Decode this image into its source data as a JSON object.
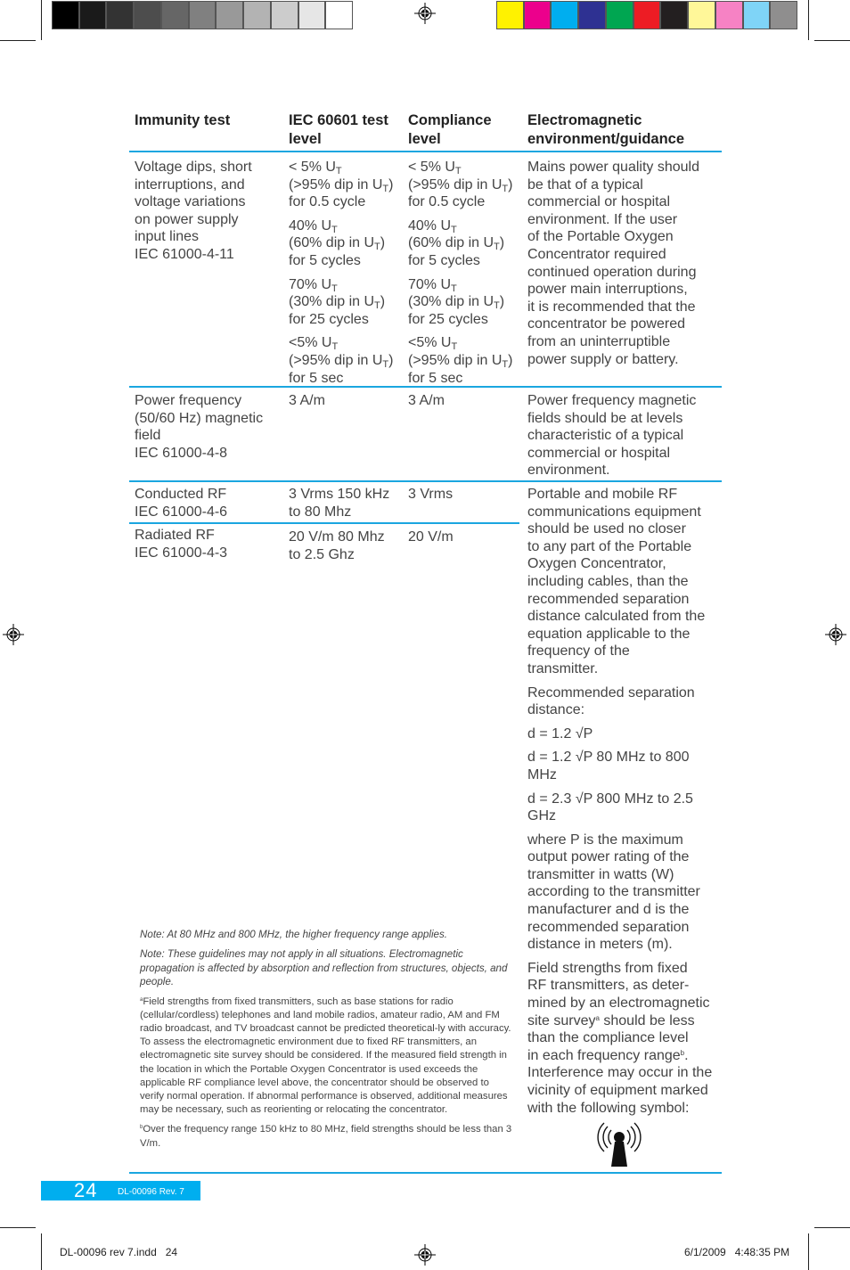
{
  "print_marks": {
    "gray_swatches": [
      "#000000",
      "#1a1a1a",
      "#333333",
      "#4d4d4d",
      "#666666",
      "#808080",
      "#999999",
      "#b3b3b3",
      "#cccccc",
      "#e6e6e6",
      "#ffffff"
    ],
    "color_swatches": [
      "#fff200",
      "#ec008c",
      "#00aeef",
      "#2e3192",
      "#00a651",
      "#ed1c24",
      "#231f20",
      "#fff799",
      "#f682c4",
      "#7fd4f7",
      "#8f8e8e"
    ],
    "slug_left": "DL-00096 rev 7.indd   24",
    "slug_right": "6/1/2009   4:48:35 PM"
  },
  "table": {
    "headers": [
      "Immunity test",
      "IEC 60601 test level",
      "Compliance level",
      "Electromagnetic environment/guidance"
    ],
    "rows": {
      "voltage": {
        "test": [
          "Voltage dips, short",
          "interruptions, and",
          "voltage variations",
          "on power supply",
          "input lines",
          "IEC 61000-4-11"
        ],
        "iec_levels": [
          {
            "pre": "< 5% U",
            "sub": "T",
            "dip_pre": "(>95% dip in U",
            "dip_sub": "T",
            "dip_post": ")",
            "duration": "for 0.5 cycle"
          },
          {
            "pre": "40% U",
            "sub": "T",
            "dip_pre": "(60% dip in U",
            "dip_sub": "T",
            "dip_post": ")",
            "duration": "for 5 cycles"
          },
          {
            "pre": "70% U",
            "sub": "T",
            "dip_pre": "(30% dip in U",
            "dip_sub": "T",
            "dip_post": ")",
            "duration": "for 25 cycles"
          },
          {
            "pre": "<5% U",
            "sub": "T",
            "dip_pre": "(>95% dip in U",
            "dip_sub": "T",
            "dip_post": ")",
            "duration": "for 5 sec"
          }
        ],
        "compliance_levels": [
          {
            "pre": "< 5% U",
            "sub": "T",
            "dip_pre": "(>95% dip in U",
            "dip_sub": "T",
            "dip_post": ")",
            "duration": "for 0.5 cycle"
          },
          {
            "pre": "40% U",
            "sub": "T",
            "dip_pre": "(60% dip in U",
            "dip_sub": "T",
            "dip_post": ")",
            "duration": "for 5 cycles"
          },
          {
            "pre": "70% U",
            "sub": "T",
            "dip_pre": "(30% dip in U",
            "dip_sub": "T",
            "dip_post": ")",
            "duration": "for 25 cycles"
          },
          {
            "pre": "<5% U",
            "sub": "T",
            "dip_pre": "(>95% dip in U",
            "dip_sub": "T",
            "dip_post": ")",
            "duration": "for 5 sec"
          }
        ],
        "guidance": [
          "Mains power quality should",
          "be that of a typical",
          "commercial or hospital",
          "environment. If the user",
          "of the Portable Oxygen",
          "Concentrator required",
          "continued operation during",
          "power main interruptions,",
          "it is recommended that the",
          "concentrator be powered",
          "from an uninterruptible",
          "power supply or battery."
        ]
      },
      "power_freq": {
        "test": [
          "Power frequency",
          "(50/60 Hz) magnetic",
          "field",
          "IEC 61000-4-8"
        ],
        "iec_level": "3 A/m",
        "compliance": "3 A/m",
        "guidance": [
          "Power frequency magnetic",
          "fields should be at levels",
          "characteristic of a typical",
          "commercial or hospital",
          "environment."
        ]
      },
      "conducted": {
        "test": [
          "Conducted RF",
          "IEC 61000-4-6"
        ],
        "iec_level": [
          "3 Vrms 150 kHz",
          "to 80 Mhz"
        ],
        "compliance": "3 Vrms"
      },
      "radiated": {
        "test": [
          "Radiated RF",
          "IEC 61000-4-3"
        ],
        "iec_level": [
          "20 V/m 80 Mhz",
          "to 2.5 Ghz"
        ],
        "compliance": "20 V/m"
      },
      "rf_guidance": {
        "intro": [
          "Portable and mobile RF",
          "communications equipment",
          "should be used no closer",
          "to any part of the Portable",
          "Oxygen Concentrator,",
          "including cables, than the",
          "recommended separation",
          "distance calculated from the",
          "equation applicable to the",
          "frequency of the",
          "transmitter."
        ],
        "sep_label": [
          "Recommended separation",
          "distance:"
        ],
        "eq1": "d = 1.2 √P",
        "eq2": [
          "d = 1.2 √P 80 MHz to 800",
          "MHz"
        ],
        "eq3": [
          "d = 2.3 √P 800 MHz to 2.5",
          "GHz"
        ],
        "where": [
          "where P is the maximum",
          "output power rating of the",
          "transmitter in watts (W)",
          "according to the transmitter",
          "manufacturer and d is the",
          "recommended separation",
          "distance in meters (m)."
        ],
        "field1": "Field strengths from fixed",
        "field2": "RF transmitters, as deter-",
        "field3": "mined by an electromagnetic",
        "field4_pre": "site survey",
        "field4_sup": "a",
        "field4_post": " should be less",
        "field5": "than the compliance level",
        "field6_pre": "in each frequency range",
        "field6_sup": "b",
        "field6_post": ".",
        "field7": "Interference may occur in the",
        "field8": "vicinity of equipment marked",
        "field9": "with the following symbol:",
        "symbol_icon": "non-ionizing-radiation-icon"
      }
    }
  },
  "notes": {
    "note1": "Note: At 80 MHz and 800 MHz, the higher frequency range applies.",
    "note2": "Note: These guidelines may not apply in all situations. Electromagnetic propagation is affected by absorption and reflection from structures, objects, and people.",
    "footnote_a_mark": "a",
    "footnote_a": "Field strengths from fixed transmitters, such as base stations for radio (cellular/cordless) telephones and land mobile radios, amateur radio, AM and FM radio broadcast, and TV broadcast cannot be predicted theoretical-ly with accuracy. To assess the electromagnetic environment due to fixed RF transmitters, an electromagnetic site survey should be considered. If the measured field strength in the location in which the Portable Oxygen Concentrator is used exceeds the applicable RF compliance level above, the concentrator should be observed to verify normal operation. If abnormal performance is observed, additional measures may be necessary, such as reorienting or relocating the concentrator.",
    "footnote_b_mark": "b",
    "footnote_b": "Over the frequency range 150 kHz to 80 MHz, field strengths should be less than 3 V/m."
  },
  "footer": {
    "page_number": "24",
    "doc_id": "DL-00096 Rev. 7",
    "accent_color": "#00aeef"
  }
}
